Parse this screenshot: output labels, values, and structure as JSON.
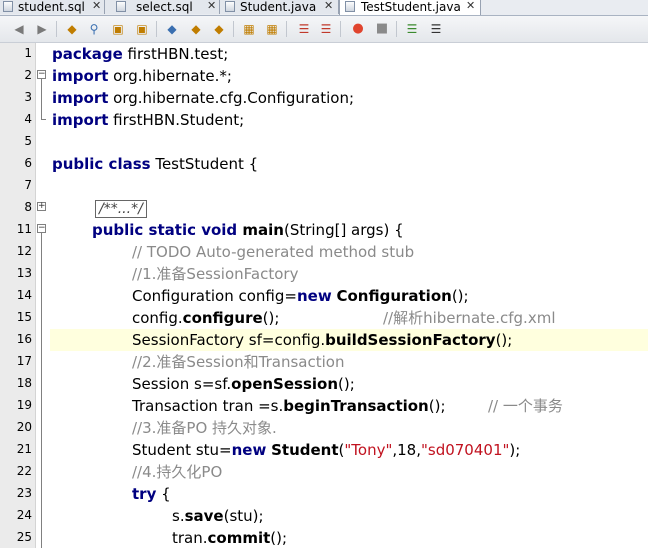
{
  "tabs": [
    {
      "label": "student.sql",
      "close": "✕"
    },
    {
      "label": "select.sql",
      "close": "✕"
    },
    {
      "label": "Student.java",
      "close": "✕"
    },
    {
      "label": "TestStudent.java",
      "close": "✕"
    }
  ],
  "toolbar": {
    "icons": [
      "back-icon",
      "forward-icon",
      "find-selection-icon",
      "find-icon",
      "find-previous-icon",
      "find-next-icon",
      "toggle-highlight-icon",
      "previous-bookmark-icon",
      "next-bookmark-icon",
      "toggle-bookmark-icon",
      "shift-left-icon",
      "shift-right-icon",
      "record-macro-icon",
      "stop-macro-icon",
      "comment-icon",
      "uncomment-icon"
    ]
  },
  "editor": {
    "line_numbers": [
      "1",
      "2",
      "3",
      "4",
      "5",
      "6",
      "7",
      "8",
      "11",
      "12",
      "13",
      "14",
      "15",
      "16",
      "17",
      "18",
      "19",
      "20",
      "21",
      "22",
      "23",
      "24",
      "25"
    ],
    "lines": {
      "l1_kw": "package",
      "l1_rest": " firstHBN.test;",
      "l2_kw": "import",
      "l2_rest": " org.hibernate.*;",
      "l3_kw": "import",
      "l3_rest": " org.hibernate.cfg.Configuration;",
      "l4_kw": "import",
      "l4_rest": " firstHBN.Student;",
      "l6_kw": "public class",
      "l6_rest": " TestStudent {",
      "l8_fold": "/**...*/",
      "l11_kw": "public static void",
      "l11_name": " main",
      "l11_rest": "(String[] args) {",
      "l12_cm": "// TODO Auto-generated method stub",
      "l13_cm": "//1.准备SessionFactory",
      "l14_a": "Configuration config=",
      "l14_kw": "new",
      "l14_b": " ",
      "l14_name": "Configuration",
      "l14_c": "();",
      "l15_a": "config.",
      "l15_name": "configure",
      "l15_b": "();",
      "l15_cm": "//解析hibernate.cfg.xml",
      "l16_a": "SessionFactory sf=config.",
      "l16_name": "buildSessionFactory",
      "l16_b": "();",
      "l17_cm": "//2.准备Session和Transaction",
      "l18_a": "Session s=sf.",
      "l18_name": "openSession",
      "l18_b": "();",
      "l19_a": "Transaction tran =s.",
      "l19_name": "beginTransaction",
      "l19_b": "();",
      "l19_cm": "// 一个事务",
      "l20_cm": "//3.准备PO 持久对象.",
      "l21_a": "Student stu=",
      "l21_kw": "new",
      "l21_b": " ",
      "l21_name": "Student",
      "l21_c": "(",
      "l21_s1": "\"Tony\"",
      "l21_d": ",18,",
      "l21_s2": "\"sd070401\"",
      "l21_e": ");",
      "l22_cm": "//4.持久化PO",
      "l23_kw": "try",
      "l23_rest": " {",
      "l24_a": "s.",
      "l24_name": "save",
      "l24_b": "(stu);",
      "l25_a": "tran.",
      "l25_name": "commit",
      "l25_b": "();"
    }
  },
  "colors": {
    "keyword": "#000080",
    "comment": "#8a8a8a",
    "string": "#c1121f",
    "current_line": "#ffffde"
  }
}
